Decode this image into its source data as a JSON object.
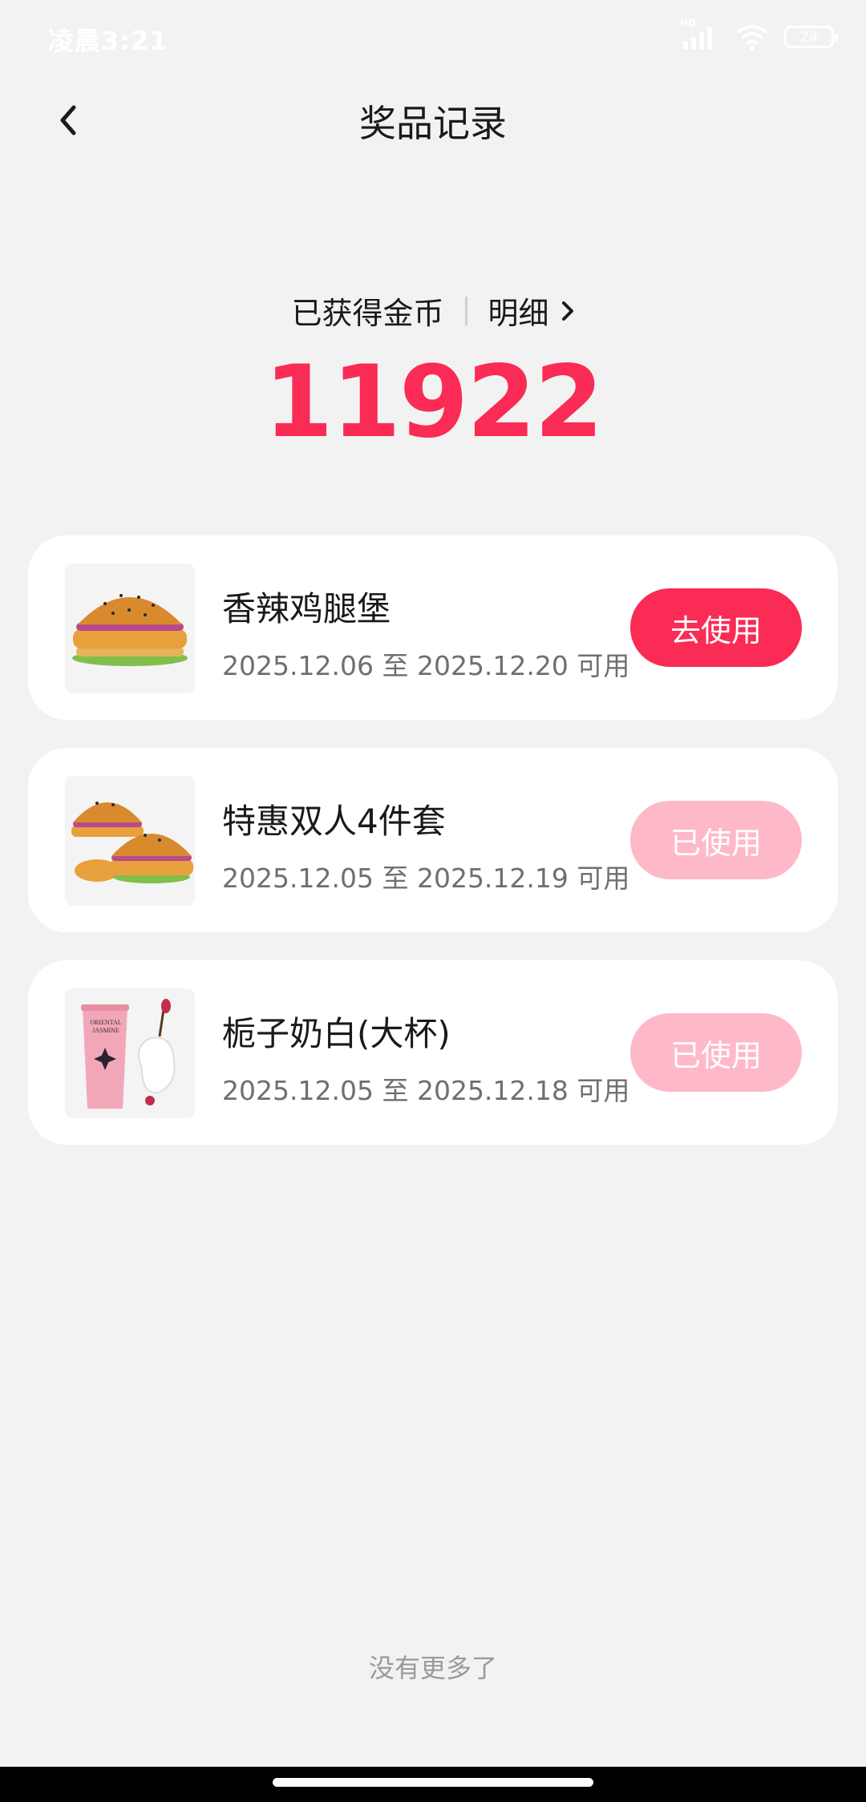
{
  "status_bar": {
    "time": "凌晨3:21",
    "battery": "24",
    "network_label": "HD"
  },
  "header": {
    "title": "奖品记录"
  },
  "coins": {
    "label": "已获得金币",
    "detail_label": "明细",
    "value": "11922"
  },
  "prizes": [
    {
      "name": "香辣鸡腿堡",
      "date_start": "2025.12.06",
      "connector": "至",
      "date_end": "2025.12.20",
      "suffix": "可用",
      "button_label": "去使用",
      "status": "active"
    },
    {
      "name": "特惠双人4件套",
      "date_start": "2025.12.05",
      "connector": "至",
      "date_end": "2025.12.19",
      "suffix": "可用",
      "button_label": "已使用",
      "status": "used"
    },
    {
      "name": "栀子奶白(大杯)",
      "date_start": "2025.12.05",
      "connector": "至",
      "date_end": "2025.12.18",
      "suffix": "可用",
      "button_label": "已使用",
      "status": "used"
    }
  ],
  "footer": {
    "no_more": "没有更多了"
  },
  "drink_cup_label": "ORIENTAL JASMINE",
  "colors": {
    "accent": "#fa2b55",
    "used_button": "#feb9c8",
    "background": "#f2f2f2"
  }
}
